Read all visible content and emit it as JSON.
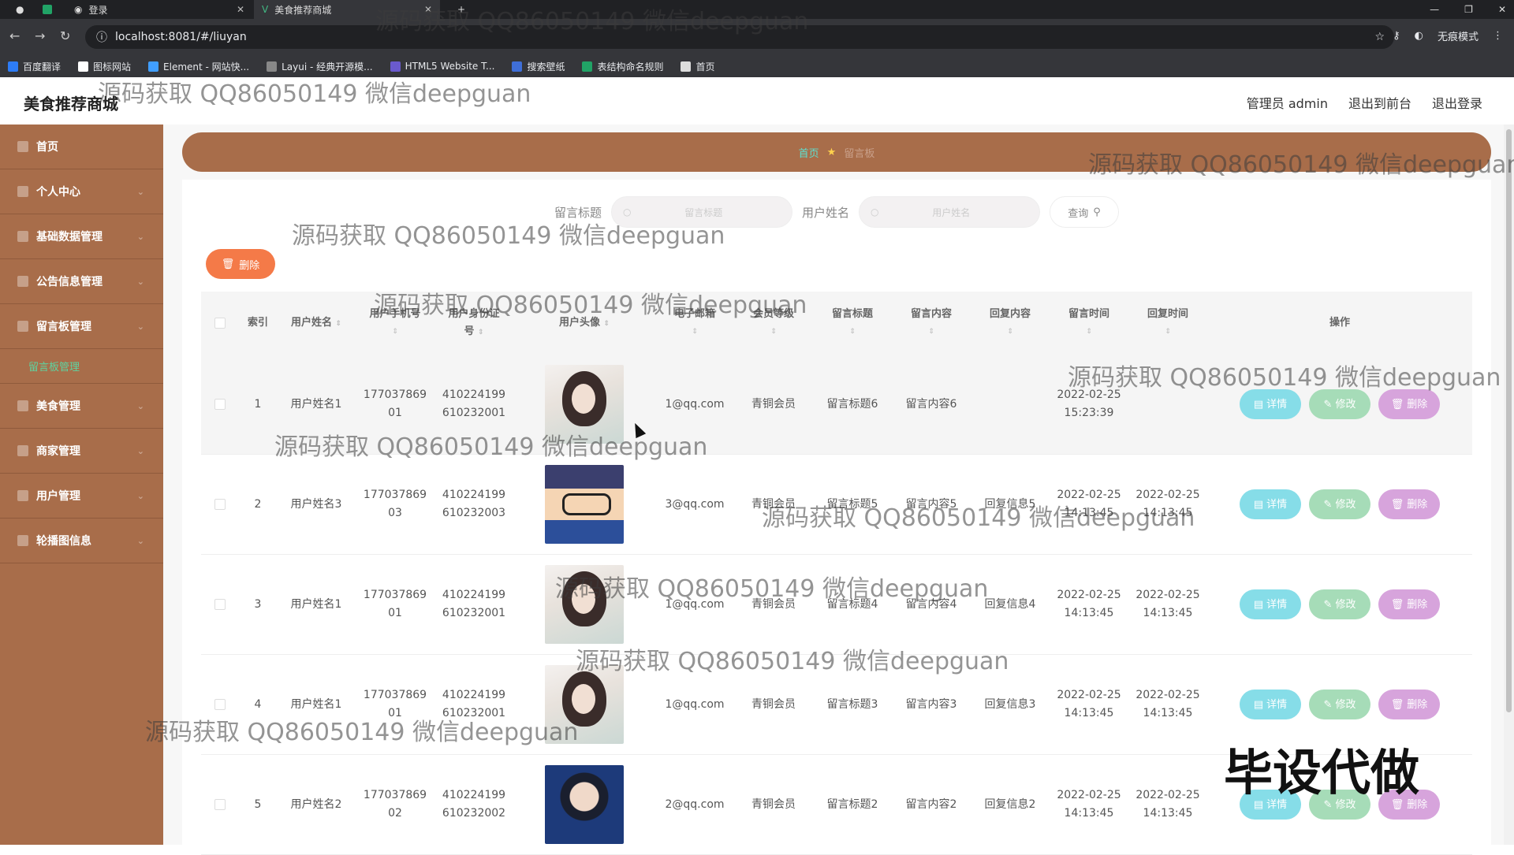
{
  "browser": {
    "tabs": [
      {
        "label": "登录"
      },
      {
        "label": "美食推荐商城"
      }
    ],
    "url": "localhost:8081/#/liuyan",
    "incognito_label": "无痕模式",
    "bookmarks": [
      {
        "label": "百度翻译",
        "color": "#2d7cf6"
      },
      {
        "label": "图标网站",
        "color": "#ffffff"
      },
      {
        "label": "Element - 网站快...",
        "color": "#409eff"
      },
      {
        "label": "Layui - 经典开源模...",
        "color": "#888888"
      },
      {
        "label": "HTML5 Website T...",
        "color": "#6a5acd"
      },
      {
        "label": "搜索壁纸",
        "color": "#3f6fd8"
      },
      {
        "label": "表结构命名规则",
        "color": "#21a366"
      },
      {
        "label": "首页",
        "color": "#dddddd"
      }
    ]
  },
  "header": {
    "title": "美食推荐商城",
    "admin_label": "管理员 admin",
    "back_label": "退出到前台",
    "logout_label": "退出登录"
  },
  "sidebar": {
    "items": [
      {
        "label": "首页"
      },
      {
        "label": "个人中心"
      },
      {
        "label": "基础数据管理"
      },
      {
        "label": "公告信息管理"
      },
      {
        "label": "留言板管理"
      },
      {
        "label": "美食管理"
      },
      {
        "label": "商家管理"
      },
      {
        "label": "用户管理"
      },
      {
        "label": "轮播图信息"
      }
    ],
    "submenu_label": "留言板管理"
  },
  "breadcrumb": {
    "home": "首页",
    "current": "留言板"
  },
  "search": {
    "title_label": "留言标题",
    "title_placeholder": "留言标题",
    "name_label": "用户姓名",
    "name_placeholder": "用户姓名",
    "query_label": "查询"
  },
  "toolbar": {
    "delete_label": "删除"
  },
  "table": {
    "headers": {
      "index": "索引",
      "name": "用户姓名",
      "phone": "用户手机号",
      "idcard_1": "用户身份证",
      "idcard_2": "号",
      "avatar": "用户头像",
      "email": "电子邮箱",
      "level": "会员等级",
      "title": "留言标题",
      "content": "留言内容",
      "reply": "回复内容",
      "time": "留言时间",
      "reply_time": "回复时间",
      "ops": "操作"
    },
    "rows": [
      {
        "index": "1",
        "name": "用户姓名1",
        "phone_a": "177037869",
        "phone_b": "01",
        "id_a": "410224199",
        "id_b": "610232001",
        "email": "1@qq.com",
        "level": "青铜会员",
        "title": "留言标题6",
        "content": "留言内容6",
        "reply": "",
        "time_a": "2022-02-25",
        "time_b": "15:23:39",
        "rtime_a": "",
        "rtime_b": "",
        "avatar": "girl"
      },
      {
        "index": "2",
        "name": "用户姓名3",
        "phone_a": "177037869",
        "phone_b": "03",
        "id_a": "410224199",
        "id_b": "610232003",
        "email": "3@qq.com",
        "level": "青铜会员",
        "title": "留言标题5",
        "content": "留言内容5",
        "reply": "回复信息5",
        "time_a": "2022-02-25",
        "time_b": "14:13:45",
        "rtime_a": "2022-02-25",
        "rtime_b": "14:13:45",
        "avatar": "conan"
      },
      {
        "index": "3",
        "name": "用户姓名1",
        "phone_a": "177037869",
        "phone_b": "01",
        "id_a": "410224199",
        "id_b": "610232001",
        "email": "1@qq.com",
        "level": "青铜会员",
        "title": "留言标题4",
        "content": "留言内容4",
        "reply": "回复信息4",
        "time_a": "2022-02-25",
        "time_b": "14:13:45",
        "rtime_a": "2022-02-25",
        "rtime_b": "14:13:45",
        "avatar": "girl"
      },
      {
        "index": "4",
        "name": "用户姓名1",
        "phone_a": "177037869",
        "phone_b": "01",
        "id_a": "410224199",
        "id_b": "610232001",
        "email": "1@qq.com",
        "level": "青铜会员",
        "title": "留言标题3",
        "content": "留言内容3",
        "reply": "回复信息3",
        "time_a": "2022-02-25",
        "time_b": "14:13:45",
        "rtime_a": "2022-02-25",
        "rtime_b": "14:13:45",
        "avatar": "girl"
      },
      {
        "index": "5",
        "name": "用户姓名2",
        "phone_a": "177037869",
        "phone_b": "02",
        "id_a": "410224199",
        "id_b": "610232002",
        "email": "2@qq.com",
        "level": "青铜会员",
        "title": "留言标题2",
        "content": "留言内容2",
        "reply": "回复信息2",
        "time_a": "2022-02-25",
        "time_b": "14:13:45",
        "rtime_a": "2022-02-25",
        "rtime_b": "14:13:45",
        "avatar": "boy"
      }
    ],
    "op_labels": {
      "detail": "详情",
      "edit": "修改",
      "delete": "删除"
    }
  },
  "watermark": {
    "text": "源码获取 QQ86050149 微信deepguan",
    "big_text": "毕设代做"
  }
}
